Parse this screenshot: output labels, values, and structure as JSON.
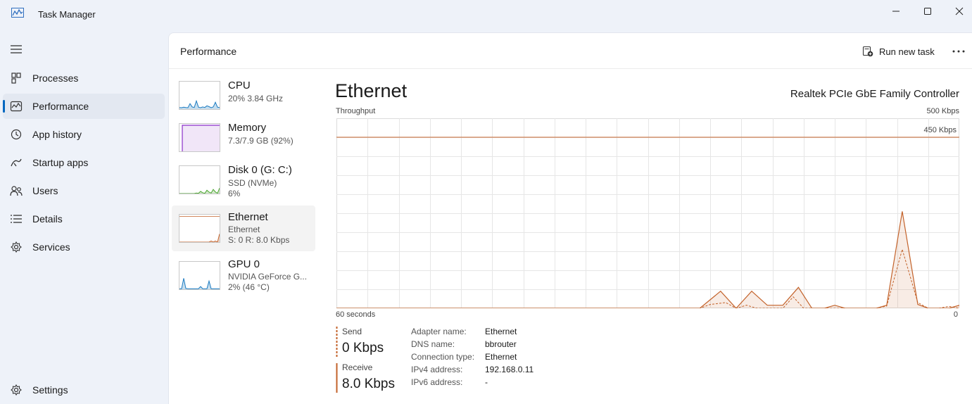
{
  "window": {
    "title": "Task Manager",
    "minimize_icon": "minimize-icon",
    "maximize_icon": "maximize-icon",
    "close_icon": "close-icon"
  },
  "sidebar": {
    "items": [
      {
        "label": "Processes",
        "icon": "processes-icon"
      },
      {
        "label": "Performance",
        "icon": "performance-icon",
        "active": true
      },
      {
        "label": "App history",
        "icon": "app-history-icon"
      },
      {
        "label": "Startup apps",
        "icon": "startup-apps-icon"
      },
      {
        "label": "Users",
        "icon": "users-icon"
      },
      {
        "label": "Details",
        "icon": "details-icon"
      },
      {
        "label": "Services",
        "icon": "services-icon"
      }
    ],
    "settings_label": "Settings"
  },
  "header": {
    "title": "Performance",
    "run_new_task": "Run new task"
  },
  "devices": [
    {
      "name": "CPU",
      "line1": "20%  3.84 GHz",
      "line2": "",
      "color": "#1c7bc1"
    },
    {
      "name": "Memory",
      "line1": "7.3/7.9 GB (92%)",
      "line2": "",
      "color": "#8b2fc9"
    },
    {
      "name": "Disk 0 (G: C:)",
      "line1": "SSD (NVMe)",
      "line2": "6%",
      "color": "#4aa52e"
    },
    {
      "name": "Ethernet",
      "line1": "Ethernet",
      "line2": "S: 0  R: 8.0 Kbps",
      "color": "#c3622a",
      "selected": true
    },
    {
      "name": "GPU 0",
      "line1": "NVIDIA GeForce G...",
      "line2": "2%  (46 °C)",
      "color": "#1c7bc1"
    }
  ],
  "detail": {
    "title": "Ethernet",
    "model": "Realtek PCIe GbE Family Controller",
    "graph_label": "Throughput",
    "graph_max": "500 Kbps",
    "graph_line_label": "450 Kbps",
    "time_label": "60 seconds",
    "min_label": "0",
    "send_label": "Send",
    "send_value": "0 Kbps",
    "receive_label": "Receive",
    "receive_value": "8.0 Kbps",
    "info": [
      {
        "key": "Adapter name:",
        "value": "Ethernet"
      },
      {
        "key": "DNS name:",
        "value": "bbrouter"
      },
      {
        "key": "Connection type:",
        "value": "Ethernet"
      },
      {
        "key": "IPv4 address:",
        "value": "192.168.0.11"
      },
      {
        "key": "IPv6 address:",
        "value": "-"
      }
    ]
  },
  "chart_data": {
    "type": "line",
    "ylim": [
      0,
      500
    ],
    "threshold": 450,
    "x_seconds": [
      0,
      2,
      4,
      6,
      8,
      10,
      12,
      14,
      16,
      18,
      20,
      22,
      24,
      26,
      28,
      30,
      32,
      34,
      36,
      38,
      40,
      42,
      44,
      46,
      48,
      50,
      52,
      54,
      56,
      58,
      60
    ],
    "series": [
      {
        "name": "Receive",
        "values": [
          0,
          0,
          0,
          0,
          0,
          0,
          0,
          0,
          0,
          0,
          0,
          0,
          0,
          0,
          0,
          0,
          0,
          0,
          0,
          0,
          0,
          0,
          0,
          0,
          0,
          0,
          0,
          0,
          0,
          0,
          0
        ]
      },
      {
        "name": "Send",
        "values": [
          0,
          0,
          0,
          0,
          0,
          0,
          0,
          0,
          0,
          0,
          0,
          0,
          0,
          0,
          0,
          0,
          0,
          0,
          0,
          0,
          0,
          0,
          0,
          0,
          0,
          0,
          0,
          0,
          0,
          0,
          0
        ]
      }
    ],
    "receive_points": [
      [
        0,
        0
      ],
      [
        35,
        0
      ],
      [
        37,
        45
      ],
      [
        38.5,
        0
      ],
      [
        40,
        45
      ],
      [
        41.5,
        8
      ],
      [
        43,
        8
      ],
      [
        44.5,
        55
      ],
      [
        45.8,
        0
      ],
      [
        47,
        0
      ],
      [
        48,
        8
      ],
      [
        49,
        0
      ],
      [
        52,
        0
      ],
      [
        53,
        8
      ],
      [
        54.5,
        255
      ],
      [
        56,
        10
      ],
      [
        57,
        0
      ],
      [
        58,
        0
      ],
      [
        59,
        0
      ],
      [
        60,
        8
      ]
    ],
    "send_points": [
      [
        0,
        0
      ],
      [
        35,
        0
      ],
      [
        36,
        10
      ],
      [
        37.5,
        15
      ],
      [
        38.5,
        0
      ],
      [
        39.5,
        8
      ],
      [
        40.5,
        0
      ],
      [
        43,
        0
      ],
      [
        44,
        30
      ],
      [
        45,
        0
      ],
      [
        52,
        0
      ],
      [
        53,
        6
      ],
      [
        54.5,
        155
      ],
      [
        56,
        15
      ],
      [
        57,
        0
      ],
      [
        58,
        0
      ],
      [
        59,
        5
      ],
      [
        60,
        0
      ]
    ]
  },
  "thumb_data": {
    "cpu": [
      6,
      5,
      7,
      6,
      5,
      20,
      8,
      6,
      30,
      7,
      5,
      8,
      6,
      12,
      9,
      5,
      8,
      25,
      7,
      6
    ],
    "memory": [
      92,
      92,
      92,
      92,
      92,
      92,
      92,
      92,
      92,
      92,
      92,
      92,
      92,
      92,
      92,
      92,
      92,
      92,
      92,
      92
    ],
    "disk": [
      0,
      0,
      0,
      0,
      0,
      0,
      0,
      0,
      2,
      1,
      8,
      3,
      1,
      12,
      5,
      2,
      15,
      6,
      1,
      20
    ],
    "ethernet": [
      0,
      0,
      0,
      0,
      0,
      0,
      0,
      0,
      0,
      0,
      0,
      0,
      0,
      0,
      0,
      4,
      0,
      4,
      0,
      30
    ],
    "gpu": [
      2,
      2,
      40,
      3,
      2,
      2,
      2,
      2,
      2,
      2,
      10,
      2,
      2,
      2,
      30,
      2,
      2,
      2,
      2,
      2
    ]
  }
}
